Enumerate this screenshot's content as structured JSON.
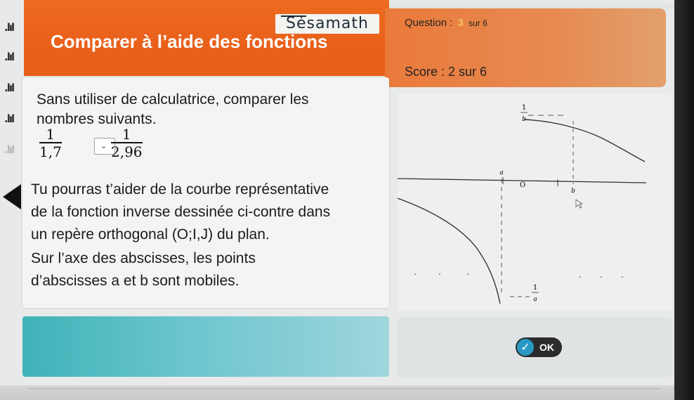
{
  "header": {
    "logo": "Sésamath",
    "title": "Comparer à l’aide des fonctions",
    "question_label": "Question :",
    "question_number": "3",
    "question_total": "sur 6",
    "score": "Score : 2 sur 6"
  },
  "question": {
    "line1": "Sans utiliser de calculatrice, comparer les",
    "line2": "nombres suivants.",
    "left_fraction": {
      "numerator": "1",
      "denominator": "1,7"
    },
    "right_fraction": {
      "numerator": "1",
      "denominator": "2,96"
    },
    "hint_lines": [
      "Tu pourras t’aider de la courbe représentative",
      "de la fonction inverse dessinée ci-contre dans",
      "un repère orthogonal (O;I,J) du plan.",
      "Sur l’axe des abscisses, les points",
      "d’abscisses a et b sont mobiles."
    ]
  },
  "graph": {
    "label_1_over_b_num": "1",
    "label_1_over_b_den": "b",
    "label_1_over_a_num": "1",
    "label_1_over_a_den": "a",
    "label_a": "a",
    "label_origin": "O",
    "label_b": "b"
  },
  "ok_button": {
    "label": "OK"
  },
  "colors": {
    "banner": "#e9601a",
    "answer_panel": "#3fb3b8",
    "ok_button": "#2b2b2b",
    "ok_check": "#2a9ac5"
  }
}
